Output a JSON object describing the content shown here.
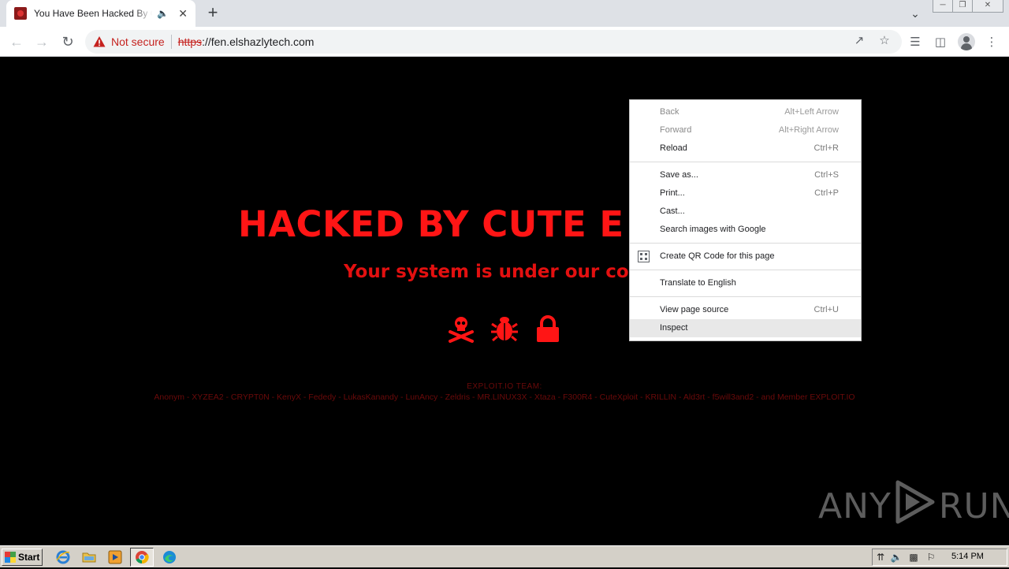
{
  "browser": {
    "tab_title": "You Have Been Hacked By Cute",
    "address": {
      "security_label": "Not secure",
      "protocol": "https",
      "rest": "://fen.elshazlytech.com"
    }
  },
  "page": {
    "headline": "HACKED BY CUTE E",
    "subheadline": "Your system is under our con",
    "team_heading": "EXPLOIT.IO TEAM:",
    "team_members": "Anonym - XYZEA2 - CRYPT0N - KenyX - Fededy - LukasKanandy - LunAncy - Zeldris - MR.LINUX3X - Xtaza - F300R4 - CuteXploit - KRILLIN - Ald3rt - f5will3and2 - and Member EXPLOIT.IO",
    "accent_color": "#ff1515"
  },
  "context_menu": {
    "items": [
      {
        "label": "Back",
        "shortcut": "Alt+Left Arrow",
        "disabled": true
      },
      {
        "label": "Forward",
        "shortcut": "Alt+Right Arrow",
        "disabled": true
      },
      {
        "label": "Reload",
        "shortcut": "Ctrl+R"
      },
      {
        "label": "Save as...",
        "shortcut": "Ctrl+S"
      },
      {
        "label": "Print...",
        "shortcut": "Ctrl+P"
      },
      {
        "label": "Cast..."
      },
      {
        "label": "Search images with Google"
      },
      {
        "label": "Create QR Code for this page",
        "icon": "qr-code-icon"
      },
      {
        "label": "Translate to English"
      },
      {
        "label": "View page source",
        "shortcut": "Ctrl+U"
      },
      {
        "label": "Inspect",
        "highlighted": true
      }
    ]
  },
  "watermark": {
    "left": "ANY",
    "right": "RUN"
  },
  "taskbar": {
    "start_label": "Start",
    "clock": "5:14 PM"
  }
}
